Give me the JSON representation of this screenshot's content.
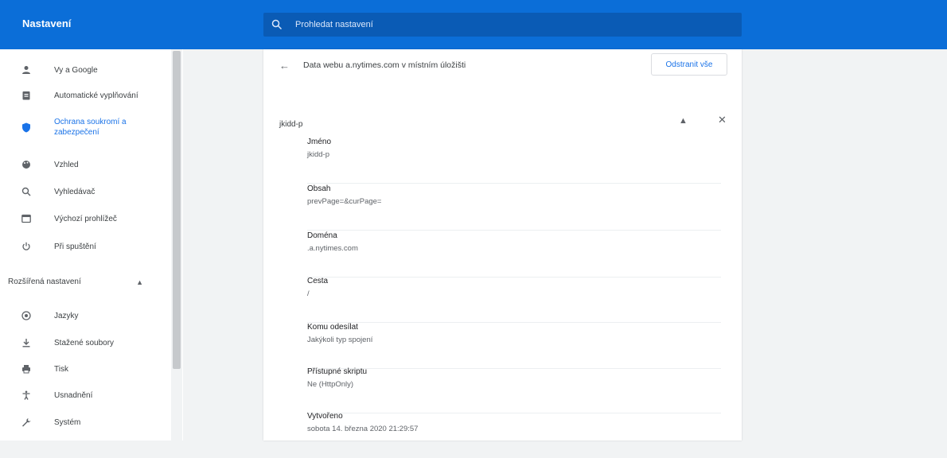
{
  "header": {
    "title": "Nastavení",
    "search_placeholder": "Prohledat nastavení"
  },
  "sidebar": {
    "items": [
      {
        "label": "Vy a Google",
        "icon": "person-icon"
      },
      {
        "label": "Automatické vyplňování",
        "icon": "clipboard-icon"
      },
      {
        "label": "Ochrana soukromí a zabezpečení",
        "icon": "shield-icon",
        "active": true
      },
      {
        "label": "Vzhled",
        "icon": "palette-icon"
      },
      {
        "label": "Vyhledávač",
        "icon": "search-icon"
      },
      {
        "label": "Výchozí prohlížeč",
        "icon": "browser-icon"
      },
      {
        "label": "Při spuštění",
        "icon": "power-icon"
      }
    ],
    "advanced_label": "Rozšířená nastavení",
    "advanced_caret": "▲",
    "advanced_items": [
      {
        "label": "Jazyky",
        "icon": "globe-icon"
      },
      {
        "label": "Stažené soubory",
        "icon": "download-icon"
      },
      {
        "label": "Tisk",
        "icon": "printer-icon"
      },
      {
        "label": "Usnadnění",
        "icon": "accessibility-icon"
      },
      {
        "label": "Systém",
        "icon": "wrench-icon"
      }
    ]
  },
  "main": {
    "breadcrumb": "Data webu a.nytimes.com v místním úložišti",
    "back_icon": "←",
    "remove_all_label": "Odstranit vše",
    "cookie_name": "jkidd-p",
    "collapse_icon": "▲",
    "close_icon": "✕",
    "fields": [
      {
        "label": "Jméno",
        "value": "jkidd-p"
      },
      {
        "label": "Obsah",
        "value": "prevPage=&curPage="
      },
      {
        "label": "Doména",
        "value": ".a.nytimes.com"
      },
      {
        "label": "Cesta",
        "value": "/"
      },
      {
        "label": "Komu odesílat",
        "value": "Jakýkoli typ spojení"
      },
      {
        "label": "Přístupné skriptu",
        "value": "Ne (HttpOnly)"
      },
      {
        "label": "Vytvořeno",
        "value": "sobota 14. března 2020 21:29:57"
      }
    ]
  },
  "colors": {
    "topbar": "#0b6ed8",
    "search": "#0a5bb5",
    "accent": "#1a73e8"
  }
}
